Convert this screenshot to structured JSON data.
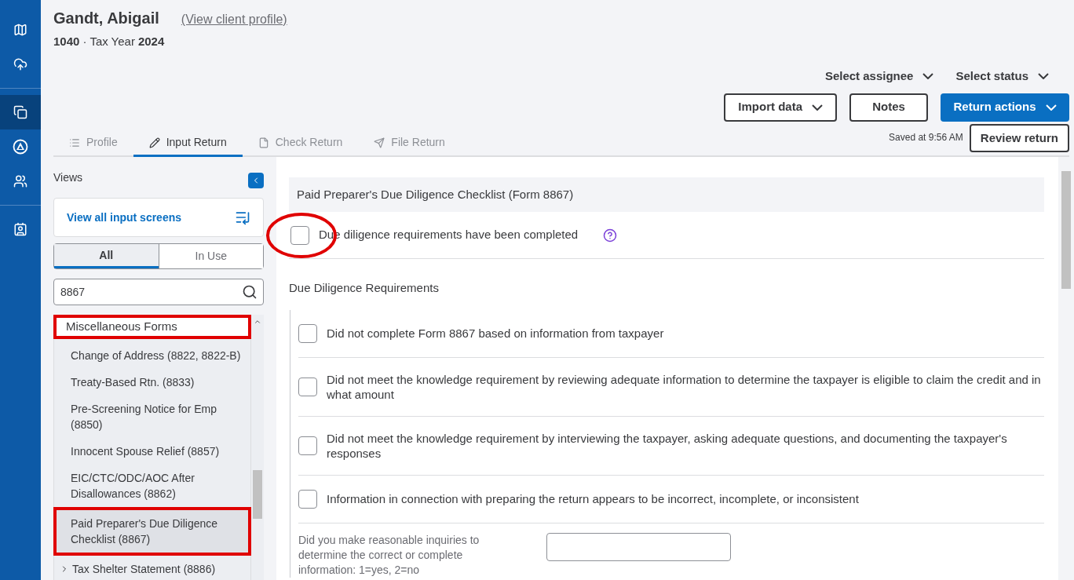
{
  "nav_rail": [
    {
      "kind": "map",
      "selected": false
    },
    {
      "kind": "cloud",
      "selected": false
    },
    {
      "kind": "copy",
      "selected": true
    },
    {
      "kind": "triangle",
      "selected": false
    },
    {
      "kind": "people",
      "selected": false
    },
    {
      "kind": "contact",
      "selected": false
    }
  ],
  "client": {
    "name": "Gandt, Abigail",
    "profile_link": "(View client profile)",
    "form": "1040",
    "separator": "·",
    "tax_year_label": "Tax Year",
    "tax_year": "2024"
  },
  "header_dropdowns": [
    "Select assignee",
    "Select status"
  ],
  "actions": [
    {
      "label": "Import data",
      "kind": "outline",
      "caret": true
    },
    {
      "label": "Notes",
      "kind": "outline",
      "caret": false
    },
    {
      "label": "Return actions",
      "kind": "primary",
      "caret": true
    }
  ],
  "saved_status": "Saved at 9:56 AM",
  "review_button": "Review return",
  "tabs": [
    {
      "label": "Profile",
      "selected": false
    },
    {
      "label": "Input Return",
      "selected": true
    },
    {
      "label": "Check Return",
      "selected": false
    },
    {
      "label": "File Return",
      "selected": false
    }
  ],
  "sidebar": {
    "views_label": "Views",
    "view_all": "View all input screens",
    "filters": [
      {
        "label": "All",
        "selected": true
      },
      {
        "label": "In Use",
        "selected": false
      }
    ],
    "search": {
      "value": "8867"
    },
    "group": {
      "label": "Miscellaneous Forms",
      "highlighted": true
    },
    "items": [
      {
        "label": "Change of Address (8822, 8822-B)",
        "selected": false,
        "highlighted": false,
        "expandable": false
      },
      {
        "label": "Treaty-Based Rtn. (8833)",
        "selected": false,
        "highlighted": false,
        "expandable": false
      },
      {
        "label": "Pre-Screening Notice for Emp (8850)",
        "selected": false,
        "highlighted": false,
        "expandable": false
      },
      {
        "label": "Innocent Spouse Relief (8857)",
        "selected": false,
        "highlighted": false,
        "expandable": false
      },
      {
        "label": "EIC/CTC/ODC/AOC After Disallowances (8862)",
        "selected": false,
        "highlighted": false,
        "expandable": false
      },
      {
        "label": "Paid Preparer's Due Diligence Checklist (8867)",
        "selected": true,
        "highlighted": true,
        "expandable": false
      },
      {
        "label": "Tax Shelter Statement (8886)",
        "selected": false,
        "highlighted": false,
        "expandable": true
      }
    ]
  },
  "form": {
    "title": "Paid Preparer's Due Diligence Checklist (Form 8867)",
    "completed": {
      "label": "Due diligence requirements have been completed",
      "checked": false,
      "circled": true
    },
    "section_title": "Due Diligence Requirements",
    "requirements": [
      {
        "label": "Did not complete Form 8867 based on information from taxpayer",
        "checked": false
      },
      {
        "label": "Did not meet the knowledge requirement by reviewing adequate information to determine the taxpayer is eligible to claim the credit and in what amount",
        "checked": false
      },
      {
        "label": "Did not meet the knowledge requirement by interviewing the taxpayer, asking adequate questions, and documenting the taxpayer's responses",
        "checked": false
      },
      {
        "label": "Information in connection with preparing the return appears to be incorrect, incomplete, or inconsistent",
        "checked": false
      }
    ],
    "question": {
      "label": "Did you make reasonable inquiries to determine the correct or complete information: 1=yes, 2=no"
    }
  }
}
